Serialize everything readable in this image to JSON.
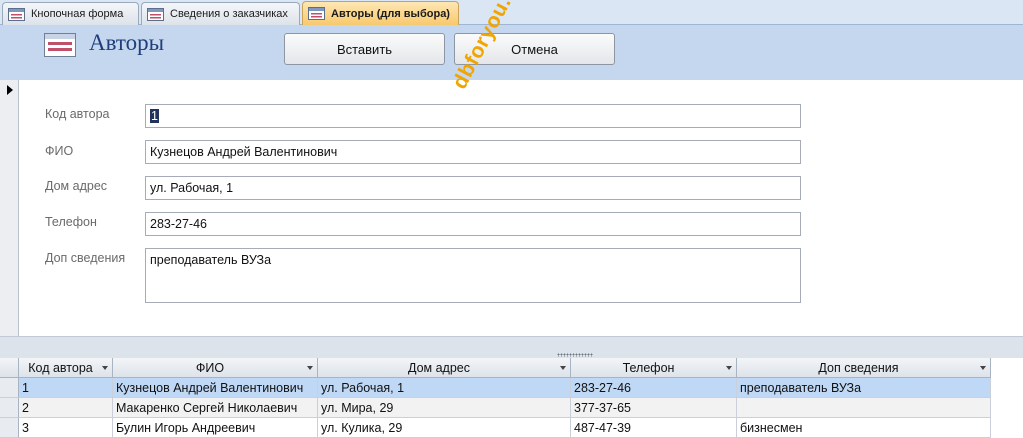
{
  "tabs": [
    {
      "label": "Кнопочная форма",
      "active": false
    },
    {
      "label": "Сведения о заказчиках",
      "active": false
    },
    {
      "label": "Авторы (для выбора)",
      "active": true
    }
  ],
  "form": {
    "title": "Авторы",
    "insert_label": "Вставить",
    "cancel_label": "Отмена",
    "fields": [
      {
        "label": "Код автора",
        "value": "1"
      },
      {
        "label": "ФИО",
        "value": "Кузнецов Андрей Валентинович"
      },
      {
        "label": "Дом адрес",
        "value": "ул. Рабочая, 1"
      },
      {
        "label": "Телефон",
        "value": "283-27-46"
      },
      {
        "label": "Доп сведения",
        "value": "преподаватель ВУЗа"
      }
    ]
  },
  "watermark": "dbforyou.ru",
  "grid": {
    "columns": [
      "Код автора",
      "ФИО",
      "Дом адрес",
      "Телефон",
      "Доп сведения"
    ],
    "rows": [
      [
        "1",
        "Кузнецов Андрей Валентинович",
        "ул. Рабочая, 1",
        "283-27-46",
        "преподаватель ВУЗа"
      ],
      [
        "2",
        "Макаренко Сергей Николаевич",
        "ул. Мира, 29",
        "377-37-65",
        ""
      ],
      [
        "3",
        "Булин Игорь Андреевич",
        "ул. Кулика, 29",
        "487-47-39",
        "бизнесмен"
      ]
    ]
  },
  "colors": {
    "accent": "#f8c96c",
    "header_bg": "#c5d7ee",
    "title": "#1f3f7a",
    "selected_row": "#bfd8f5",
    "watermark": "#f0a500"
  }
}
